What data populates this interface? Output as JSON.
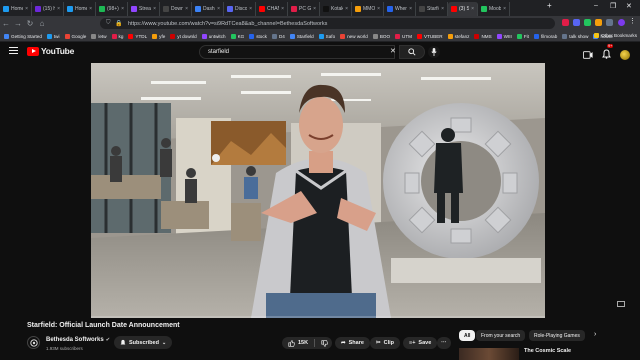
{
  "browser": {
    "tabs": [
      {
        "label": "Home /",
        "color": "#1d9bf0",
        "active": false
      },
      {
        "label": "(15) Ho",
        "color": "#6d28d9",
        "active": false
      },
      {
        "label": "Home /",
        "color": "#1d9bf0",
        "active": false
      },
      {
        "label": "(98+) Cl",
        "color": "#1db954",
        "active": false
      },
      {
        "label": "Stream",
        "color": "#9146ff",
        "active": false
      },
      {
        "label": "Downlo",
        "color": "#444",
        "active": false
      },
      {
        "label": "DashMo",
        "color": "#3b82f6",
        "active": false
      },
      {
        "label": "Discord",
        "color": "#5865f2",
        "active": false
      },
      {
        "label": "CHANN",
        "color": "#ff0000",
        "active": false
      },
      {
        "label": "PC Gam",
        "color": "#e11d48",
        "active": false
      },
      {
        "label": "Kotaku",
        "color": "#111",
        "active": false
      },
      {
        "label": "MMO V",
        "color": "#f59e0b",
        "active": false
      },
      {
        "label": "Where",
        "color": "#2563eb",
        "active": false
      },
      {
        "label": "Starfield |",
        "color": "#444",
        "active": false
      },
      {
        "label": "(3) St",
        "color": "#ff0000",
        "active": true,
        "sub": "Playing"
      },
      {
        "label": "Moobot",
        "color": "#22c55e",
        "active": false
      }
    ],
    "url": "https://www.youtube.com/watch?v=si9RdTCea8&ab_channel=BethesdaSoftworks",
    "bookmarks": [
      "Getting Started",
      "twi",
      "Google",
      "letw",
      "kg",
      "YTDL",
      "yfe",
      "yt downld",
      "untwitch",
      "KG",
      "stock",
      "D4",
      "Starfield",
      "Safo",
      "new world",
      "BOO",
      "UTM",
      "VTUBER",
      "stefanz",
      "NMS",
      "WIII",
      "Fit",
      "filmorab",
      "talk show",
      "house"
    ],
    "other_bookmarks": "Other Bookmarks"
  },
  "youtube": {
    "logo_text": "YouTube",
    "search_value": "starfield",
    "notification_count": "9+"
  },
  "video": {
    "title": "Starfield: Official Launch Date Announcement",
    "channel": "Bethesda Softworks",
    "subscribers": "1.93M subscribers",
    "subscribe_label": "Subscribed",
    "likes": "15K",
    "share_label": "Share",
    "clip_label": "Clip",
    "save_label": "Save",
    "progress": 0.0
  },
  "chips": [
    "All",
    "From your search",
    "Role-Playing Games"
  ],
  "recommendation": {
    "title": "The Cosmic Scale"
  }
}
